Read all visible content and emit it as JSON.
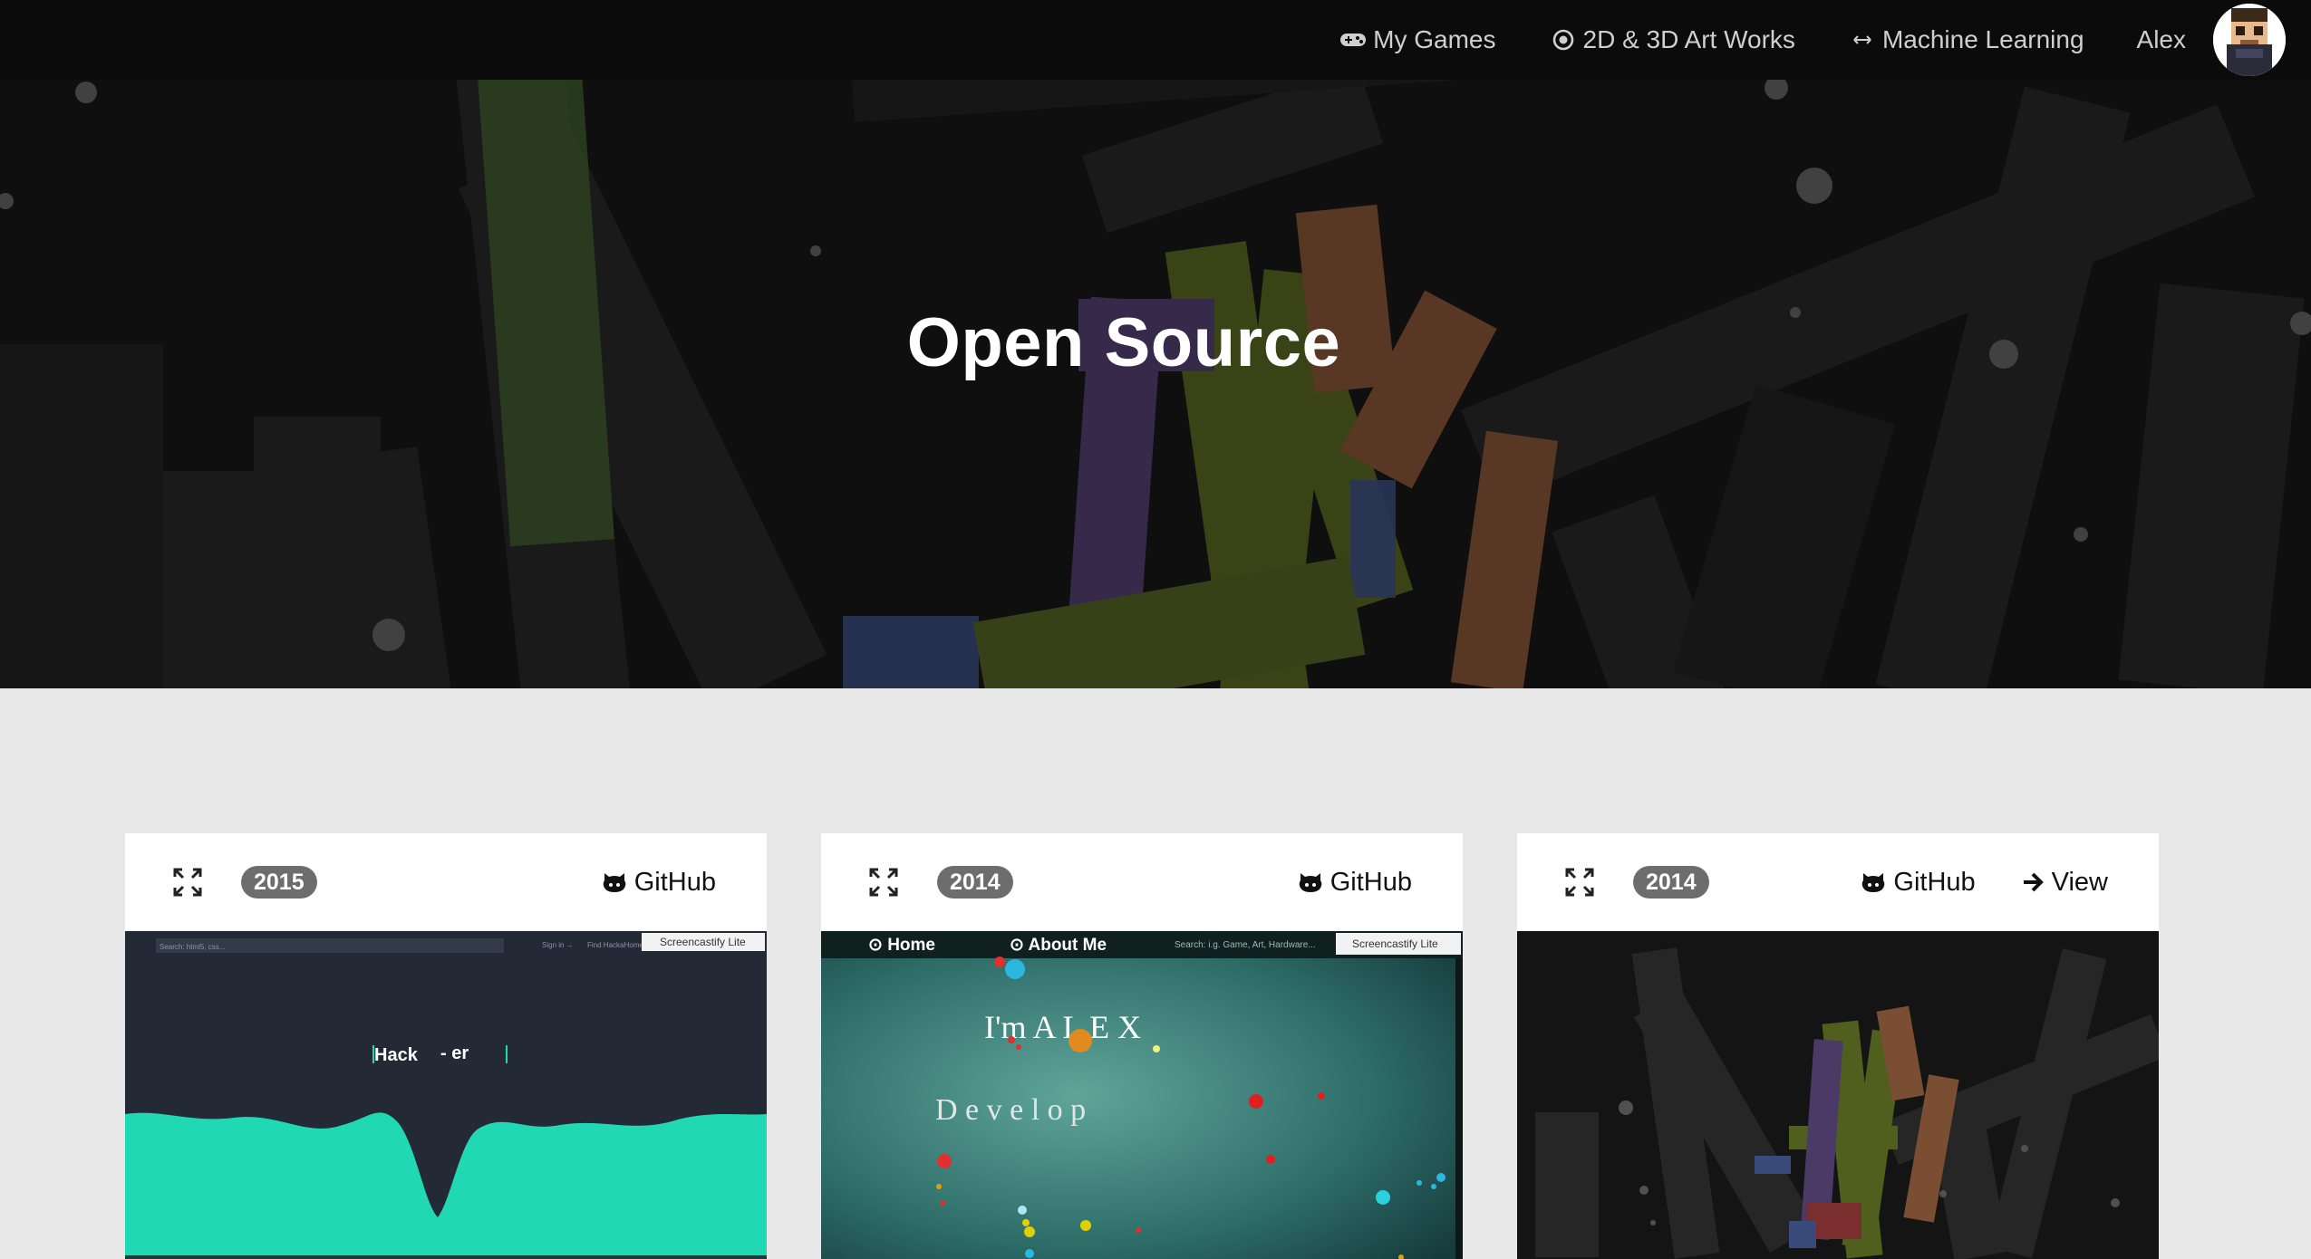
{
  "nav": {
    "items": [
      {
        "label": "My Games",
        "icon": "gamepad-icon"
      },
      {
        "label": "2D & 3D Art Works",
        "icon": "target-icon"
      },
      {
        "label": "Machine Learning",
        "icon": "arrows-icon"
      }
    ],
    "user": "Alex"
  },
  "hero": {
    "title": "Open Source"
  },
  "cards": [
    {
      "year": "2015",
      "links": [
        "GitHub"
      ],
      "media": {
        "search_placeholder": "Search: html5, css...",
        "sign_in": "Sign in →",
        "find": "Find HackaHome",
        "badge": "Screencastify Lite",
        "title_left": "Hack",
        "title_right": "- er",
        "accent": "#20d9b4"
      }
    },
    {
      "year": "2014",
      "links": [
        "GitHub"
      ],
      "media": {
        "nav_home": "⊙ Home",
        "nav_about": "⊙ About Me",
        "search": "Search: i.g. Game, Art, Hardware...",
        "badge": "Screencastify Lite",
        "headline": "I'm   A L E X",
        "subline": "D e v e l o p"
      }
    },
    {
      "year": "2014",
      "links": [
        "GitHub",
        "View"
      ]
    }
  ]
}
